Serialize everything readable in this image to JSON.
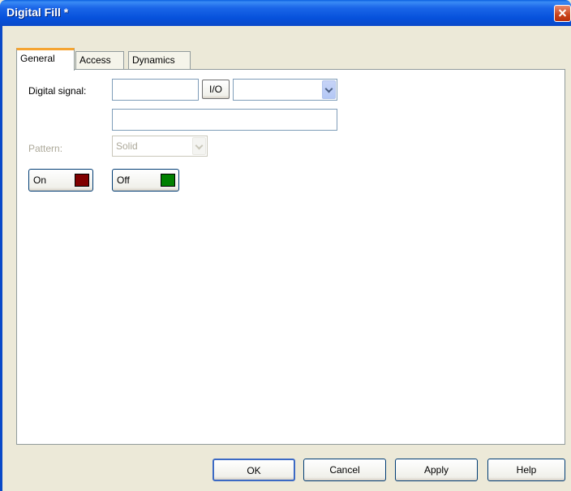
{
  "window": {
    "title": "Digital Fill *"
  },
  "tabs": [
    {
      "label": "General",
      "active": true
    },
    {
      "label": "Access",
      "active": false
    },
    {
      "label": "Dynamics",
      "active": false
    }
  ],
  "general": {
    "digital_signal_label": "Digital signal:",
    "digital_signal_value": "",
    "io_button_label": "I/O",
    "signal_combo_value": "",
    "expression_value": "",
    "pattern_label": "Pattern:",
    "pattern_value": "Solid",
    "on_button_label": "On",
    "on_color": "#800000",
    "off_button_label": "Off",
    "off_color": "#008000"
  },
  "footer": {
    "ok_label": "OK",
    "cancel_label": "Cancel",
    "apply_label": "Apply",
    "help_label": "Help"
  }
}
